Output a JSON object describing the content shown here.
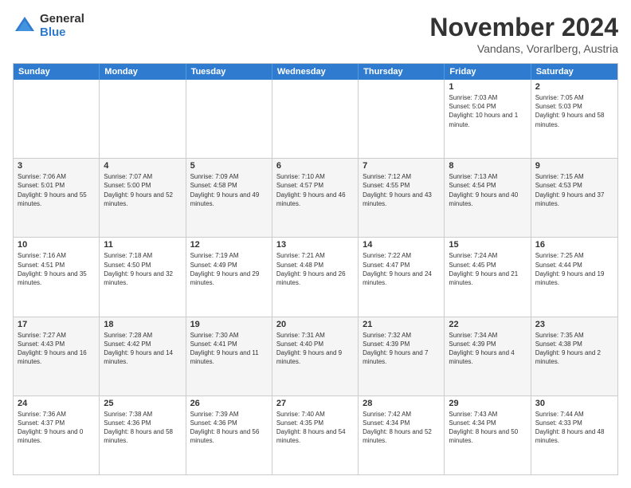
{
  "logo": {
    "general": "General",
    "blue": "Blue"
  },
  "header": {
    "title": "November 2024",
    "subtitle": "Vandans, Vorarlberg, Austria"
  },
  "weekdays": [
    "Sunday",
    "Monday",
    "Tuesday",
    "Wednesday",
    "Thursday",
    "Friday",
    "Saturday"
  ],
  "rows": [
    [
      {
        "day": "",
        "info": ""
      },
      {
        "day": "",
        "info": ""
      },
      {
        "day": "",
        "info": ""
      },
      {
        "day": "",
        "info": ""
      },
      {
        "day": "",
        "info": ""
      },
      {
        "day": "1",
        "info": "Sunrise: 7:03 AM\nSunset: 5:04 PM\nDaylight: 10 hours and 1 minute."
      },
      {
        "day": "2",
        "info": "Sunrise: 7:05 AM\nSunset: 5:03 PM\nDaylight: 9 hours and 58 minutes."
      }
    ],
    [
      {
        "day": "3",
        "info": "Sunrise: 7:06 AM\nSunset: 5:01 PM\nDaylight: 9 hours and 55 minutes."
      },
      {
        "day": "4",
        "info": "Sunrise: 7:07 AM\nSunset: 5:00 PM\nDaylight: 9 hours and 52 minutes."
      },
      {
        "day": "5",
        "info": "Sunrise: 7:09 AM\nSunset: 4:58 PM\nDaylight: 9 hours and 49 minutes."
      },
      {
        "day": "6",
        "info": "Sunrise: 7:10 AM\nSunset: 4:57 PM\nDaylight: 9 hours and 46 minutes."
      },
      {
        "day": "7",
        "info": "Sunrise: 7:12 AM\nSunset: 4:55 PM\nDaylight: 9 hours and 43 minutes."
      },
      {
        "day": "8",
        "info": "Sunrise: 7:13 AM\nSunset: 4:54 PM\nDaylight: 9 hours and 40 minutes."
      },
      {
        "day": "9",
        "info": "Sunrise: 7:15 AM\nSunset: 4:53 PM\nDaylight: 9 hours and 37 minutes."
      }
    ],
    [
      {
        "day": "10",
        "info": "Sunrise: 7:16 AM\nSunset: 4:51 PM\nDaylight: 9 hours and 35 minutes."
      },
      {
        "day": "11",
        "info": "Sunrise: 7:18 AM\nSunset: 4:50 PM\nDaylight: 9 hours and 32 minutes."
      },
      {
        "day": "12",
        "info": "Sunrise: 7:19 AM\nSunset: 4:49 PM\nDaylight: 9 hours and 29 minutes."
      },
      {
        "day": "13",
        "info": "Sunrise: 7:21 AM\nSunset: 4:48 PM\nDaylight: 9 hours and 26 minutes."
      },
      {
        "day": "14",
        "info": "Sunrise: 7:22 AM\nSunset: 4:47 PM\nDaylight: 9 hours and 24 minutes."
      },
      {
        "day": "15",
        "info": "Sunrise: 7:24 AM\nSunset: 4:45 PM\nDaylight: 9 hours and 21 minutes."
      },
      {
        "day": "16",
        "info": "Sunrise: 7:25 AM\nSunset: 4:44 PM\nDaylight: 9 hours and 19 minutes."
      }
    ],
    [
      {
        "day": "17",
        "info": "Sunrise: 7:27 AM\nSunset: 4:43 PM\nDaylight: 9 hours and 16 minutes."
      },
      {
        "day": "18",
        "info": "Sunrise: 7:28 AM\nSunset: 4:42 PM\nDaylight: 9 hours and 14 minutes."
      },
      {
        "day": "19",
        "info": "Sunrise: 7:30 AM\nSunset: 4:41 PM\nDaylight: 9 hours and 11 minutes."
      },
      {
        "day": "20",
        "info": "Sunrise: 7:31 AM\nSunset: 4:40 PM\nDaylight: 9 hours and 9 minutes."
      },
      {
        "day": "21",
        "info": "Sunrise: 7:32 AM\nSunset: 4:39 PM\nDaylight: 9 hours and 7 minutes."
      },
      {
        "day": "22",
        "info": "Sunrise: 7:34 AM\nSunset: 4:39 PM\nDaylight: 9 hours and 4 minutes."
      },
      {
        "day": "23",
        "info": "Sunrise: 7:35 AM\nSunset: 4:38 PM\nDaylight: 9 hours and 2 minutes."
      }
    ],
    [
      {
        "day": "24",
        "info": "Sunrise: 7:36 AM\nSunset: 4:37 PM\nDaylight: 9 hours and 0 minutes."
      },
      {
        "day": "25",
        "info": "Sunrise: 7:38 AM\nSunset: 4:36 PM\nDaylight: 8 hours and 58 minutes."
      },
      {
        "day": "26",
        "info": "Sunrise: 7:39 AM\nSunset: 4:36 PM\nDaylight: 8 hours and 56 minutes."
      },
      {
        "day": "27",
        "info": "Sunrise: 7:40 AM\nSunset: 4:35 PM\nDaylight: 8 hours and 54 minutes."
      },
      {
        "day": "28",
        "info": "Sunrise: 7:42 AM\nSunset: 4:34 PM\nDaylight: 8 hours and 52 minutes."
      },
      {
        "day": "29",
        "info": "Sunrise: 7:43 AM\nSunset: 4:34 PM\nDaylight: 8 hours and 50 minutes."
      },
      {
        "day": "30",
        "info": "Sunrise: 7:44 AM\nSunset: 4:33 PM\nDaylight: 8 hours and 48 minutes."
      }
    ]
  ]
}
